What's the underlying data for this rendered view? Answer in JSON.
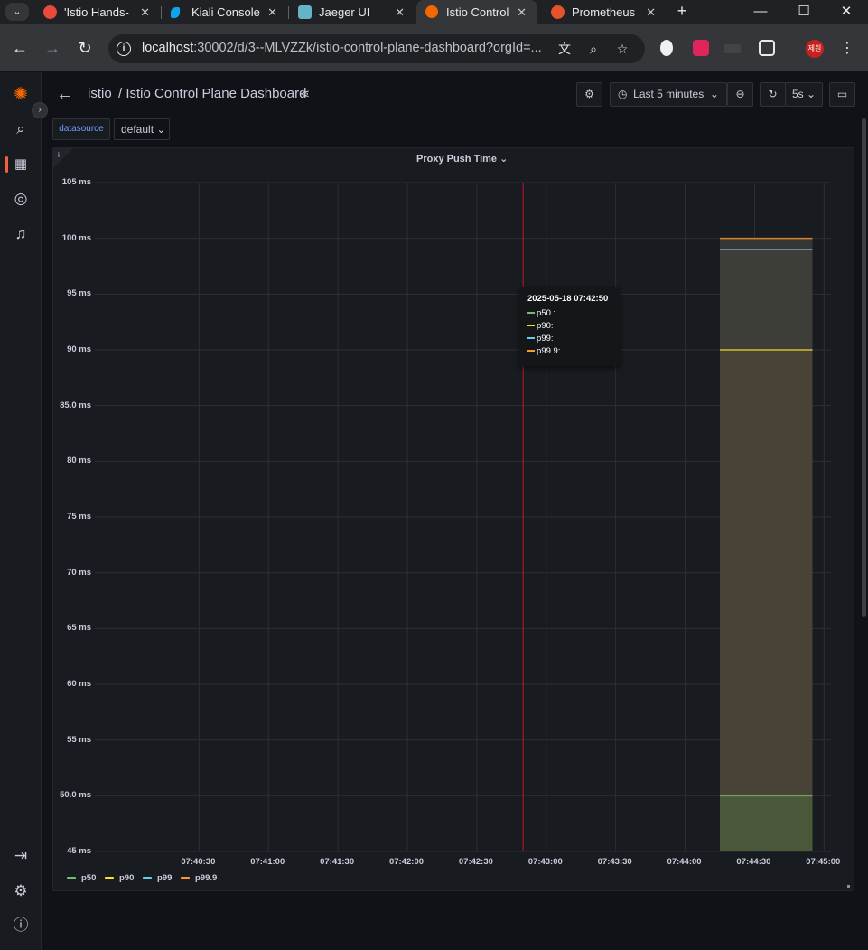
{
  "browser": {
    "tabs": [
      {
        "title": "'Istio Hands-",
        "favicon": "red-circle-icon",
        "active": false
      },
      {
        "title": "Kiali Console",
        "favicon": "kiali-icon",
        "active": false
      },
      {
        "title": "Jaeger UI",
        "favicon": "jaeger-icon",
        "active": false
      },
      {
        "title": "Istio Control",
        "favicon": "grafana-icon",
        "active": true
      },
      {
        "title": "Prometheus",
        "favicon": "prometheus-icon",
        "active": false
      }
    ],
    "url_host": "localhost",
    "url_rest": ":30002/d/3--MLVZZk/istio-control-plane-dashboard?orgId=...",
    "profile": "제원"
  },
  "dashboard": {
    "folder": "istio",
    "separator": "/ ",
    "title": "Istio Control Plane Dashboard",
    "time_range": "Last 5 minutes",
    "refresh": "5s",
    "variable_label": "datasource",
    "variable_value": "default"
  },
  "panel": {
    "title": "Proxy Push Time",
    "info": "i",
    "tooltip": {
      "time": "2025-05-18 07:42:50",
      "rows": [
        {
          "label": "p50 :",
          "color": "#73bf69"
        },
        {
          "label": "p90:",
          "color": "#fade2a"
        },
        {
          "label": "p99:",
          "color": "#5794f2"
        },
        {
          "label": "p99.9:",
          "color": "#ff9830"
        }
      ]
    }
  },
  "chart_data": {
    "type": "area",
    "title": "Proxy Push Time",
    "y_ticks": [
      "105 ms",
      "100 ms",
      "95 ms",
      "90 ms",
      "85.0 ms",
      "80 ms",
      "75 ms",
      "70 ms",
      "65 ms",
      "60 ms",
      "55 ms",
      "50.0 ms",
      "45 ms"
    ],
    "ylim": [
      45,
      105
    ],
    "x_ticks": [
      "07:40:30",
      "07:41:00",
      "07:41:30",
      "07:42:00",
      "07:42:30",
      "07:43:00",
      "07:43:30",
      "07:44:00",
      "07:44:30",
      "07:45:00"
    ],
    "hover_time": "07:42:50",
    "data_x_range": [
      "07:44:15",
      "07:44:55"
    ],
    "series": [
      {
        "name": "p50",
        "color": "#73bf69",
        "value": 50
      },
      {
        "name": "p90",
        "color": "#fade2a",
        "value": 90
      },
      {
        "name": "p99",
        "color": "#8ab8ff",
        "value": 99
      },
      {
        "name": "p99.9",
        "color": "#ff9830",
        "value": 100
      }
    ],
    "grid": true,
    "legend": "bottom-left"
  }
}
